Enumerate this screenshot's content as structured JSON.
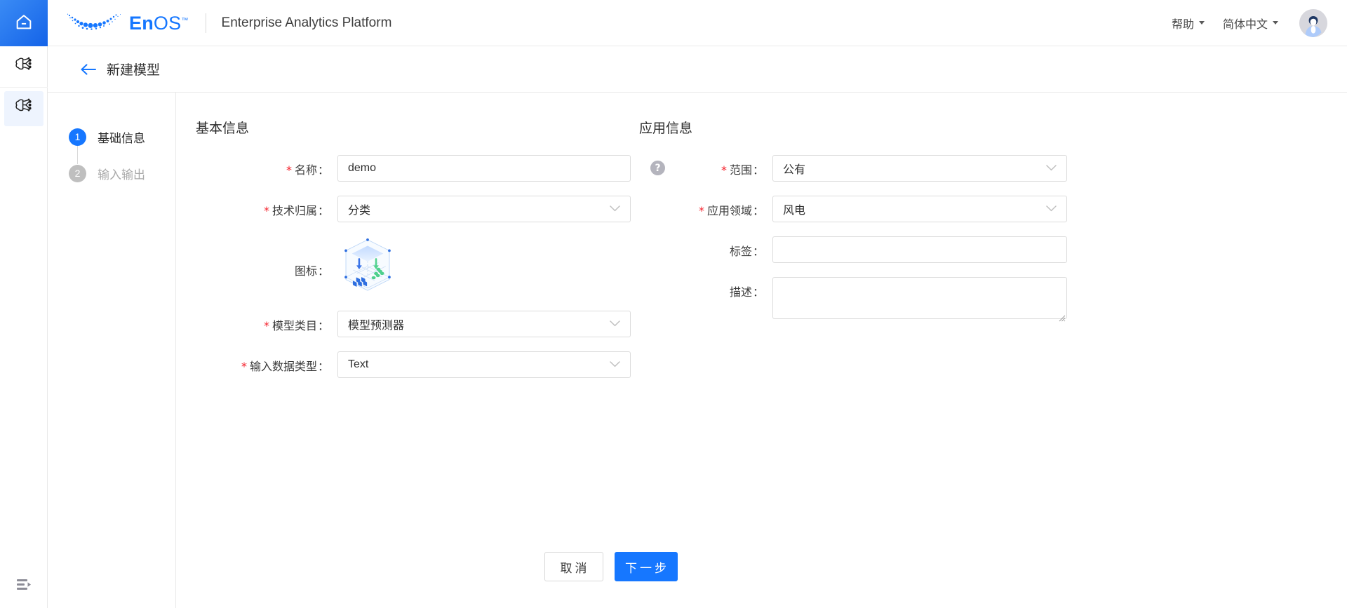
{
  "rail": {
    "home_icon": "home-icon",
    "items": [
      {
        "icon": "ai-model-icon",
        "active": false
      },
      {
        "icon": "ai-model-icon",
        "active": true
      }
    ],
    "collapse_icon": "menu-expand-icon"
  },
  "topbar": {
    "logo_mark": "enos-dots-logo",
    "logo_en": "En",
    "logo_os": "OS",
    "logo_tm": "™",
    "app_title": "Enterprise Analytics Platform",
    "help_label": "帮助",
    "language_label": "简体中文",
    "avatar": "user-avatar"
  },
  "pagehead": {
    "back_icon": "back-arrow-icon",
    "title": "新建模型"
  },
  "steps": [
    {
      "num": "1",
      "label": "基础信息",
      "state": "active"
    },
    {
      "num": "2",
      "label": "输入输出",
      "state": "inactive"
    }
  ],
  "basic": {
    "title": "基本信息",
    "name": {
      "label": "名称",
      "required": true,
      "value": "demo",
      "placeholder": "",
      "help_icon": "question-mark-icon"
    },
    "tech_category": {
      "label": "技术归属",
      "required": true,
      "value": "分类"
    },
    "icon": {
      "label": "图标",
      "required": false,
      "icon_name": "classification-cube-icon"
    },
    "model_category": {
      "label": "模型类目",
      "required": true,
      "value": "模型预测器"
    },
    "input_data_type": {
      "label": "输入数据类型",
      "required": true,
      "value": "Text"
    }
  },
  "application": {
    "title": "应用信息",
    "scope": {
      "label": "范围",
      "required": true,
      "value": "公有"
    },
    "domain": {
      "label": "应用领域",
      "required": true,
      "value": "风电"
    },
    "tag": {
      "label": "标签",
      "required": false,
      "value": "",
      "placeholder": ""
    },
    "description": {
      "label": "描述",
      "required": false,
      "value": "",
      "placeholder": ""
    }
  },
  "footer": {
    "cancel_label": "取消",
    "next_label": "下一步"
  },
  "colors": {
    "accent": "#1677ff",
    "required_star": "#f5222d",
    "step_inactive": "#bfbfbf",
    "border": "#dcdcdc"
  },
  "glyphs": {
    "colon": "：",
    "star": "*"
  }
}
